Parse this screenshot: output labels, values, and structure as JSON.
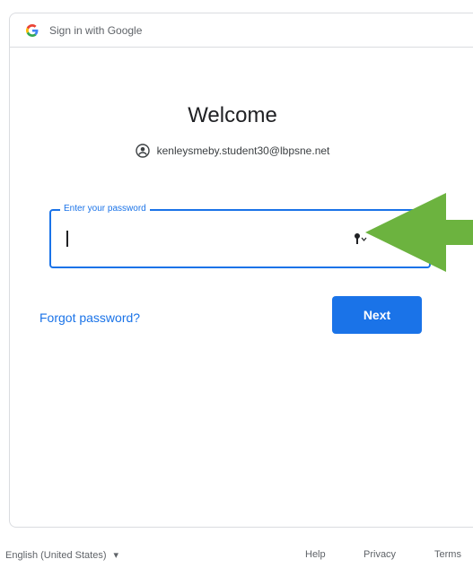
{
  "header": {
    "title": "Sign in with Google",
    "logo_icon": "google-g-icon"
  },
  "main": {
    "welcome": "Welcome",
    "account_email": "kenleysmeby.student30@lbpsne.net",
    "account_icon": "account-circle-icon"
  },
  "password": {
    "label": "Enter your password",
    "value": "",
    "key_icon": "password-key-icon"
  },
  "actions": {
    "forgot_label": "Forgot password?",
    "next_label": "Next"
  },
  "footer": {
    "language": "English (United States)",
    "links": [
      "Help",
      "Privacy",
      "Terms"
    ]
  },
  "colors": {
    "accent": "#1a73e8",
    "arrow": "#6cb33f"
  }
}
